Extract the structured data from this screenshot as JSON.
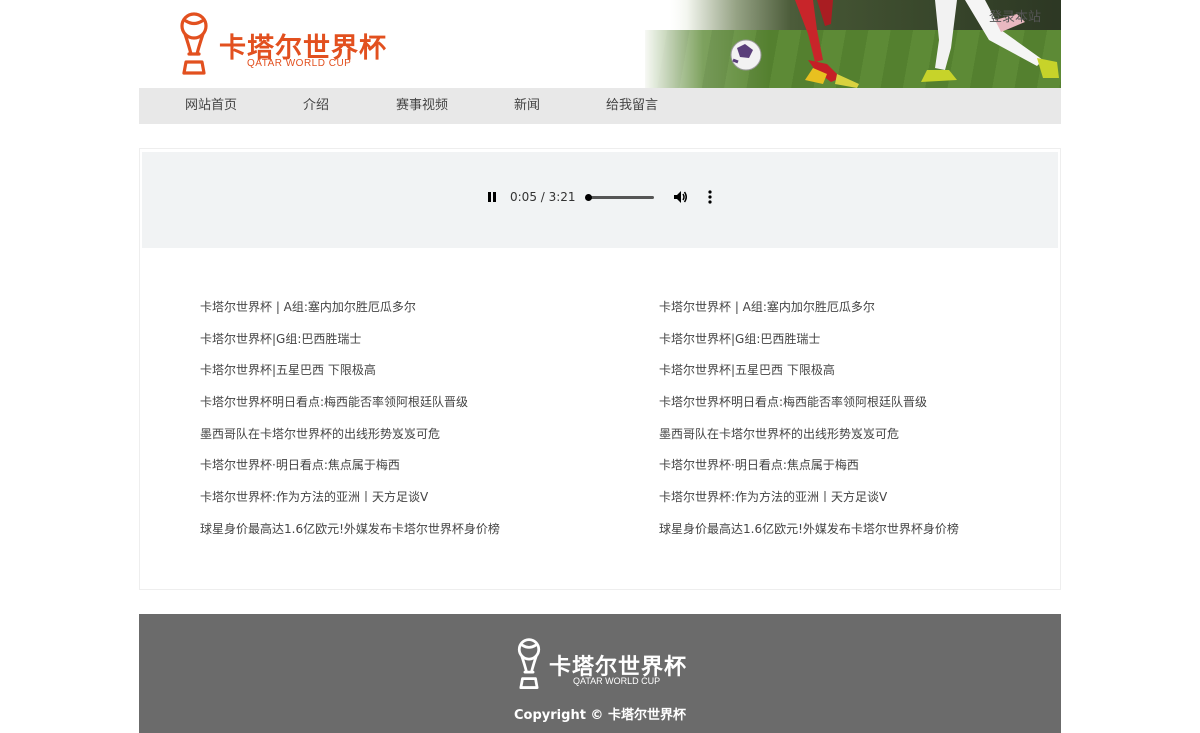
{
  "brand": {
    "name_cn": "卡塔尔世界杯",
    "name_en": "QATAR WORLD CUP",
    "color": "#e2501f"
  },
  "header": {
    "login_label": "登录本站",
    "banner": "soccer-players-banner"
  },
  "nav": {
    "items": [
      {
        "label": "网站首页"
      },
      {
        "label": "介绍"
      },
      {
        "label": "赛事视频"
      },
      {
        "label": "新闻"
      },
      {
        "label": "给我留言"
      }
    ]
  },
  "player": {
    "time": "0:05 / 3:21",
    "progress": 0.026,
    "icons": {
      "play": "pause-icon",
      "volume": "volume-icon",
      "menu": "more-vertical-icon"
    }
  },
  "articles": {
    "left": [
      "卡塔尔世界杯 | A组:塞内加尔胜厄瓜多尔",
      "卡塔尔世界杯|G组:巴西胜瑞士",
      "卡塔尔世界杯|五星巴西 下限极高",
      "卡塔尔世界杯明日看点:梅西能否率领阿根廷队晋级",
      "墨西哥队在卡塔尔世界杯的出线形势岌岌可危",
      "卡塔尔世界杯·明日看点:焦点属于梅西",
      "卡塔尔世界杯:作为方法的亚洲丨天方足谈Ⅴ",
      "球星身价最高达1.6亿欧元!外媒发布卡塔尔世界杯身价榜"
    ],
    "right": [
      "卡塔尔世界杯 | A组:塞内加尔胜厄瓜多尔",
      "卡塔尔世界杯|G组:巴西胜瑞士",
      "卡塔尔世界杯|五星巴西 下限极高",
      "卡塔尔世界杯明日看点:梅西能否率领阿根廷队晋级",
      "墨西哥队在卡塔尔世界杯的出线形势岌岌可危",
      "卡塔尔世界杯·明日看点:焦点属于梅西",
      "卡塔尔世界杯:作为方法的亚洲丨天方足谈Ⅴ",
      "球星身价最高达1.6亿欧元!外媒发布卡塔尔世界杯身价榜"
    ]
  },
  "footer": {
    "name_cn": "卡塔尔世界杯",
    "name_en": "QATAR WORLD CUP",
    "copyright": "Copyright © 卡塔尔世界杯",
    "bg_color": "#6b6b6b"
  }
}
